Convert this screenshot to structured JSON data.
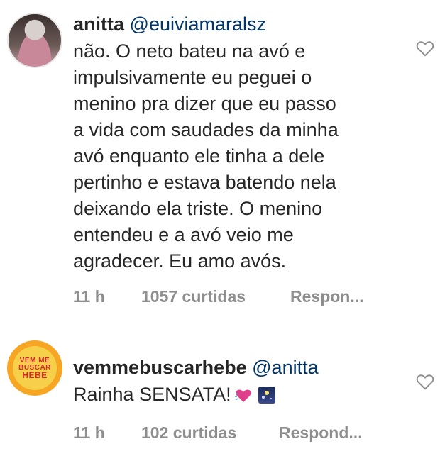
{
  "comments": [
    {
      "username": "anitta",
      "mention": "@euiviamaralsz",
      "text_lines": [
        "não. O neto bateu na avó e",
        "impulsivamente eu peguei o",
        "menino pra dizer que eu passo",
        "a vida com saudades da minha",
        "avó enquanto ele tinha a dele",
        "pertinho e estava batendo nela",
        "deixando ela triste. O menino",
        "entendeu e a avó veio me",
        "agradecer. Eu amo avós."
      ],
      "time": "11 h",
      "likes": "1057 curtidas",
      "reply": "Respon..."
    },
    {
      "username": "vemmebuscarhebe",
      "mention": "@anitta",
      "text": "Rainha SENSATA!",
      "time": "11 h",
      "likes": "102 curtidas",
      "reply": "Respond...",
      "avatar_text": [
        "VEM ME",
        "BUSCAR",
        "HEBE"
      ]
    }
  ],
  "icons": {
    "like": "heart-outline-icon",
    "emoji1": "sparkling-heart-emoji",
    "emoji2": "night-sky-emoji"
  },
  "colors": {
    "text": "#262626",
    "mention": "#003569",
    "meta": "#8e8e8e",
    "avatar2_bg": "#f6a623",
    "avatar2_text": "#d8262d"
  }
}
